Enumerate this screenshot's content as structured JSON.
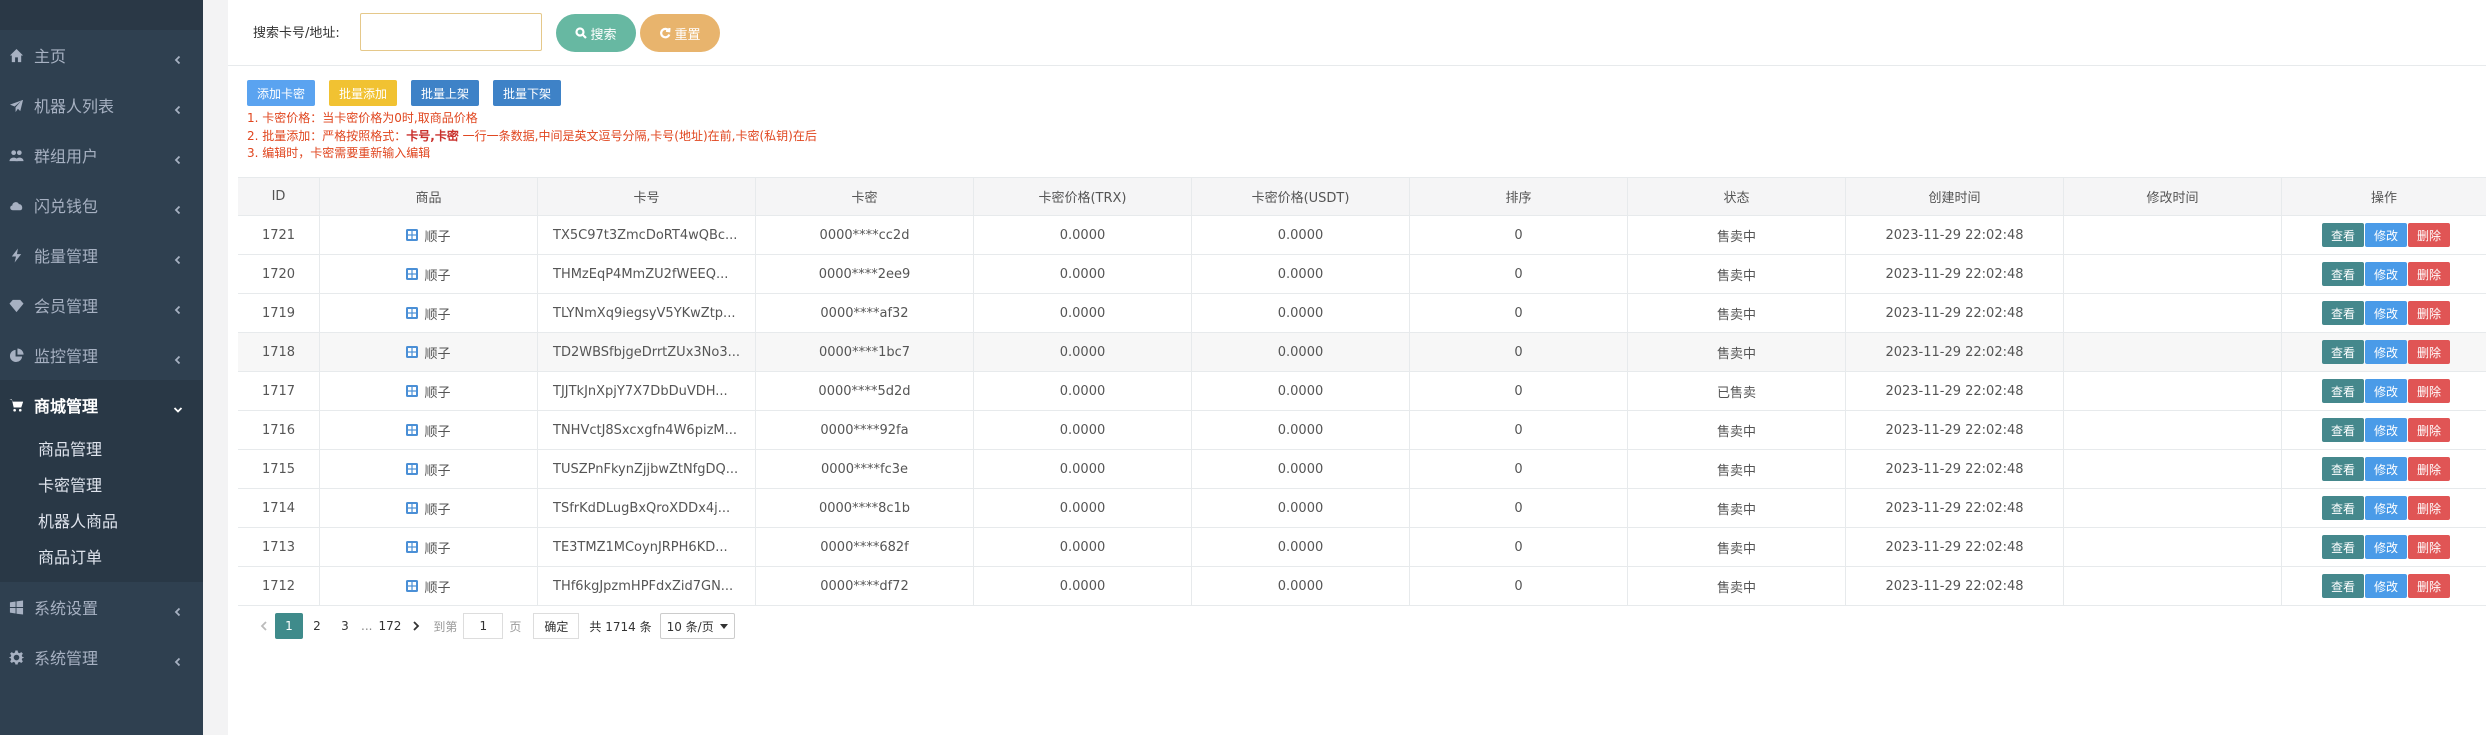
{
  "sidebar": {
    "items": [
      {
        "label": "主页",
        "icon": "home-icon"
      },
      {
        "label": "机器人列表",
        "icon": "plane-icon"
      },
      {
        "label": "群组用户",
        "icon": "users-icon"
      },
      {
        "label": "闪兑钱包",
        "icon": "cloud-icon"
      },
      {
        "label": "能量管理",
        "icon": "bolt-icon"
      },
      {
        "label": "会员管理",
        "icon": "diamond-icon"
      },
      {
        "label": "监控管理",
        "icon": "pie-icon"
      },
      {
        "label": "商城管理",
        "icon": "cart-icon"
      },
      {
        "label": "系统设置",
        "icon": "windows-icon"
      },
      {
        "label": "系统管理",
        "icon": "gear-icon"
      }
    ],
    "submenu": [
      "商品管理",
      "卡密管理",
      "机器人商品",
      "商品订单"
    ]
  },
  "search": {
    "label": "搜索卡号/地址:",
    "value": "",
    "search_button": "搜索",
    "reset_button": "重置"
  },
  "toolbar": {
    "add": "添加卡密",
    "batch_add": "批量添加",
    "batch_up": "批量上架",
    "batch_down": "批量下架"
  },
  "notes": {
    "line1": "1. 卡密价格：当卡密价格为0时,取商品价格",
    "line2_prefix": "2. 批量添加：严格按照格式：",
    "line2_bold": "卡号,卡密",
    "line2_suffix": " 一行一条数据,中间是英文逗号分隔,卡号(地址)在前,卡密(私钥)在后",
    "line3": "3. 编辑时，卡密需要重新输入编辑"
  },
  "table": {
    "headers": [
      "ID",
      "商品",
      "卡号",
      "卡密",
      "卡密价格(TRX)",
      "卡密价格(USDT)",
      "排序",
      "状态",
      "创建时间",
      "修改时间",
      "操作"
    ],
    "op_labels": {
      "view": "查看",
      "edit": "修改",
      "delete": "删除"
    },
    "rows": [
      {
        "id": "1721",
        "goods": "顺子",
        "card": "TX5C97t3ZmcDoRT4wQBc...",
        "secret": "0000****cc2d",
        "trx": "0.0000",
        "usdt": "0.0000",
        "sort": "0",
        "status": "售卖中",
        "created": "2023-11-29 22:02:48",
        "modified": ""
      },
      {
        "id": "1720",
        "goods": "顺子",
        "card": "THMzEqP4MmZU2fWEEQ...",
        "secret": "0000****2ee9",
        "trx": "0.0000",
        "usdt": "0.0000",
        "sort": "0",
        "status": "售卖中",
        "created": "2023-11-29 22:02:48",
        "modified": ""
      },
      {
        "id": "1719",
        "goods": "顺子",
        "card": "TLYNmXq9iegsyV5YKwZtp...",
        "secret": "0000****af32",
        "trx": "0.0000",
        "usdt": "0.0000",
        "sort": "0",
        "status": "售卖中",
        "created": "2023-11-29 22:02:48",
        "modified": ""
      },
      {
        "id": "1718",
        "goods": "顺子",
        "card": "TD2WBSfbjgeDrrtZUx3No3...",
        "secret": "0000****1bc7",
        "trx": "0.0000",
        "usdt": "0.0000",
        "sort": "0",
        "status": "售卖中",
        "created": "2023-11-29 22:02:48",
        "modified": ""
      },
      {
        "id": "1717",
        "goods": "顺子",
        "card": "TJJTkJnXpjY7X7DbDuVDH...",
        "secret": "0000****5d2d",
        "trx": "0.0000",
        "usdt": "0.0000",
        "sort": "0",
        "status": "已售卖",
        "created": "2023-11-29 22:02:48",
        "modified": ""
      },
      {
        "id": "1716",
        "goods": "顺子",
        "card": "TNHVctJ8Sxcxgfn4W6pizM...",
        "secret": "0000****92fa",
        "trx": "0.0000",
        "usdt": "0.0000",
        "sort": "0",
        "status": "售卖中",
        "created": "2023-11-29 22:02:48",
        "modified": ""
      },
      {
        "id": "1715",
        "goods": "顺子",
        "card": "TUSZPnFkynZjjbwZtNfgDQ...",
        "secret": "0000****fc3e",
        "trx": "0.0000",
        "usdt": "0.0000",
        "sort": "0",
        "status": "售卖中",
        "created": "2023-11-29 22:02:48",
        "modified": ""
      },
      {
        "id": "1714",
        "goods": "顺子",
        "card": "TSfrKdDLugBxQroXDDx4j...",
        "secret": "0000****8c1b",
        "trx": "0.0000",
        "usdt": "0.0000",
        "sort": "0",
        "status": "售卖中",
        "created": "2023-11-29 22:02:48",
        "modified": ""
      },
      {
        "id": "1713",
        "goods": "顺子",
        "card": "TE3TMZ1MCoynJRPH6KD...",
        "secret": "0000****682f",
        "trx": "0.0000",
        "usdt": "0.0000",
        "sort": "0",
        "status": "售卖中",
        "created": "2023-11-29 22:02:48",
        "modified": ""
      },
      {
        "id": "1712",
        "goods": "顺子",
        "card": "THf6kgJpzmHPFdxZid7GN...",
        "secret": "0000****df72",
        "trx": "0.0000",
        "usdt": "0.0000",
        "sort": "0",
        "status": "售卖中",
        "created": "2023-11-29 22:02:48",
        "modified": ""
      }
    ]
  },
  "pagination": {
    "pages": [
      "1",
      "2",
      "3"
    ],
    "ellipsis": "...",
    "last_page": "172",
    "goto_label": "到第",
    "goto_value": "1",
    "page_unit": "页",
    "confirm": "确定",
    "total": "共 1714 条",
    "per_page": "10 条/页"
  },
  "colors": {
    "sidebar_bg": "#2f4050",
    "primary_teal": "#45888c",
    "edit_blue": "#4a9be8",
    "delete_red": "#e05555",
    "note_red": "#e0461f"
  }
}
